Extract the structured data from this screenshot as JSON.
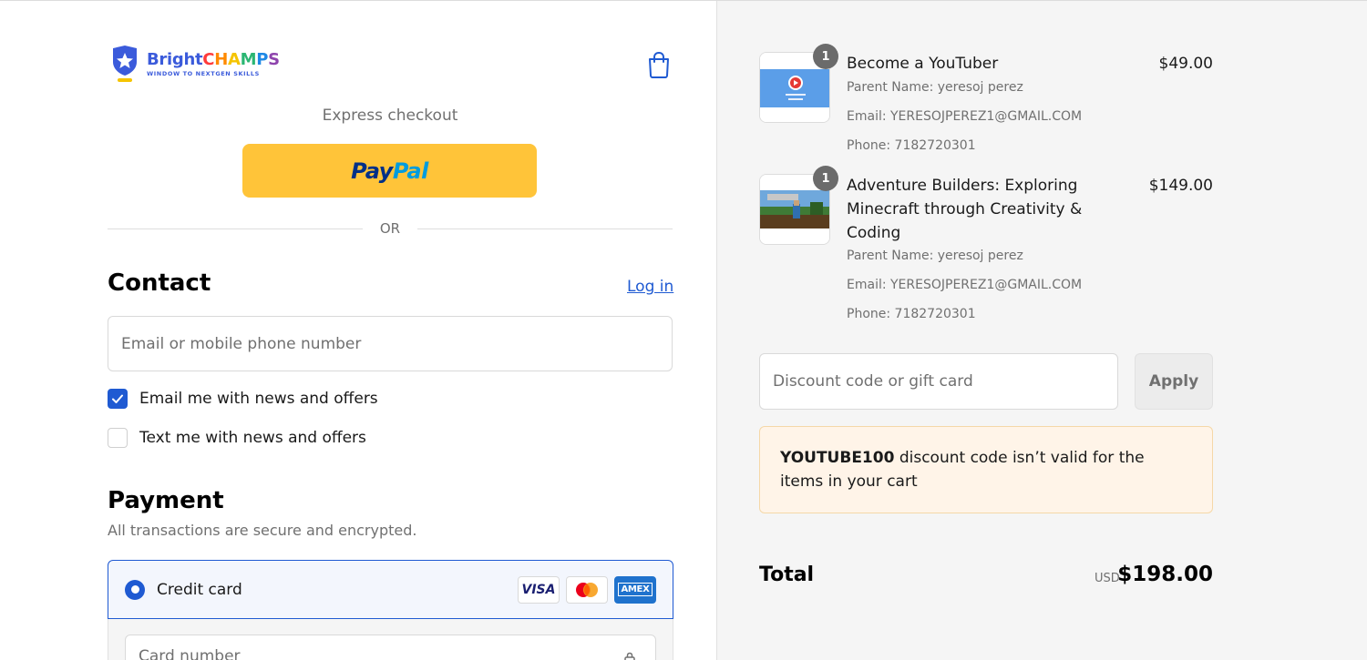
{
  "brand": {
    "name_part1": "Bright",
    "name_part2_letters": [
      "C",
      "H",
      "A",
      "M",
      "P",
      "S"
    ],
    "tagline": "WINDOW TO NEXTGEN SKILLS"
  },
  "express": {
    "label": "Express checkout",
    "paypal_part1": "Pay",
    "paypal_part2": "Pal",
    "or_label": "OR"
  },
  "contact": {
    "title": "Contact",
    "login_label": "Log in",
    "email_placeholder": "Email or mobile phone number",
    "email_value": "",
    "email_news_label": "Email me with news and offers",
    "email_news_checked": true,
    "text_news_label": "Text me with news and offers",
    "text_news_checked": false
  },
  "payment": {
    "title": "Payment",
    "subtitle": "All transactions are secure and encrypted.",
    "method_label": "Credit card",
    "card_brands": [
      "VISA",
      "mastercard-icon",
      "AMEX"
    ],
    "card_number_placeholder": "Card number"
  },
  "cart": {
    "items": [
      {
        "quantity": "1",
        "name": "Become a YouTuber",
        "price": "$49.00",
        "parent": "Parent Name: yeresoj perez",
        "email": "Email: YERESOJPEREZ1@GMAIL.COM",
        "phone": "Phone: 7182720301"
      },
      {
        "quantity": "1",
        "name": "Adventure Builders: Exploring Minecraft through Creativity & Coding",
        "price": "$149.00",
        "parent": "Parent Name: yeresoj perez",
        "email": "Email: YERESOJPEREZ1@GMAIL.COM",
        "phone": "Phone: 7182720301"
      }
    ],
    "discount_placeholder": "Discount code or gift card",
    "apply_label": "Apply",
    "notice_code": "YOUTUBE100",
    "notice_text": " discount code isn’t valid for the items in your cart",
    "total_label": "Total",
    "total_currency": "USD",
    "total_amount": "$198.00"
  },
  "colors": {
    "accent": "#1f5ad2",
    "paypal_yellow": "#ffc439",
    "notice_bg": "#fff4e8"
  }
}
